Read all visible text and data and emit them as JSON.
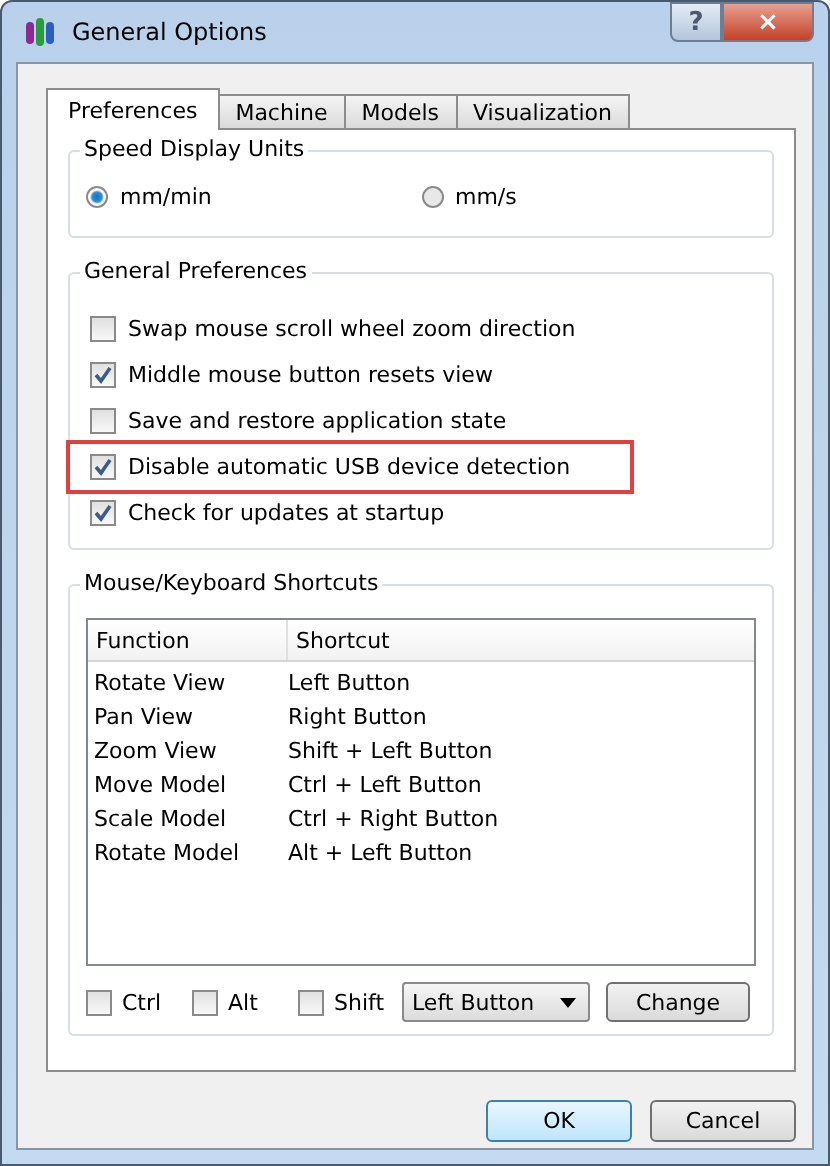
{
  "window": {
    "title": "General Options",
    "title_buttons": [
      {
        "kind": "help",
        "label": "?"
      },
      {
        "kind": "close",
        "label": "×"
      }
    ]
  },
  "tabs": [
    {
      "label": "Preferences",
      "selected": true
    },
    {
      "label": "Machine",
      "selected": false
    },
    {
      "label": "Models",
      "selected": false
    },
    {
      "label": "Visualization",
      "selected": false
    }
  ],
  "speed_group": {
    "title": "Speed Display Units",
    "options": [
      {
        "label": "mm/min",
        "selected": true
      },
      {
        "label": "mm/s",
        "selected": false
      }
    ]
  },
  "general_group": {
    "title": "General Preferences",
    "items": [
      {
        "label": "Swap mouse scroll wheel zoom direction",
        "checked": false,
        "highlighted": false
      },
      {
        "label": "Middle mouse button resets view",
        "checked": true,
        "highlighted": false
      },
      {
        "label": "Save and restore application state",
        "checked": false,
        "highlighted": false
      },
      {
        "label": "Disable automatic USB device detection",
        "checked": true,
        "highlighted": true
      },
      {
        "label": "Check for updates at startup",
        "checked": true,
        "highlighted": false
      }
    ]
  },
  "shortcuts_group": {
    "title": "Mouse/Keyboard Shortcuts",
    "table": {
      "columns": [
        "Function",
        "Shortcut"
      ],
      "rows": [
        [
          "Rotate View",
          "Left Button"
        ],
        [
          "Pan View",
          "Right Button"
        ],
        [
          "Zoom View",
          "Shift + Left Button"
        ],
        [
          "Move Model",
          "Ctrl + Left Button"
        ],
        [
          "Scale Model",
          "Ctrl + Right Button"
        ],
        [
          "Rotate Model",
          "Alt + Left Button"
        ]
      ]
    },
    "modifiers": [
      {
        "label": "Ctrl",
        "checked": false
      },
      {
        "label": "Alt",
        "checked": false
      },
      {
        "label": "Shift",
        "checked": false
      }
    ],
    "button_select": {
      "value": "Left Button"
    },
    "change_button": "Change"
  },
  "buttons": [
    {
      "label": "OK",
      "default": true
    },
    {
      "label": "Cancel",
      "default": false
    }
  ]
}
